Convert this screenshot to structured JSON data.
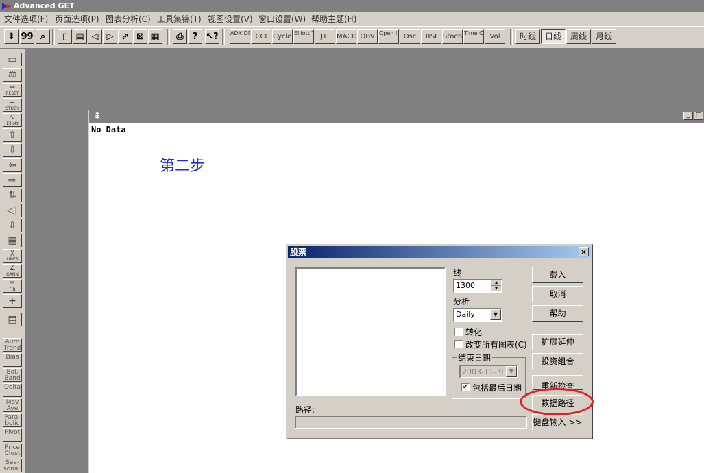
{
  "app": {
    "title": "Advanced GET"
  },
  "menu": [
    "文件选项(F)",
    "页面选项(P)",
    "图表分析(C)",
    "工具集锦(T)",
    "视图设置(V)",
    "窗口设置(W)",
    "帮助主题(H)"
  ],
  "toolbar": {
    "tools_left": [
      {
        "icon": "cursor-icon",
        "glyph": "⇞"
      },
      {
        "icon": "quote-icon",
        "glyph": "99"
      },
      {
        "icon": "magnifier-icon",
        "glyph": "⌕"
      },
      {
        "icon": "page-icon",
        "glyph": "▯"
      },
      {
        "icon": "save-icon",
        "glyph": "▤"
      },
      {
        "icon": "back-icon",
        "glyph": "◁"
      },
      {
        "icon": "forward-icon",
        "glyph": "▷"
      },
      {
        "icon": "export-icon",
        "glyph": "⇗"
      },
      {
        "icon": "delete-page-icon",
        "glyph": "⊠"
      },
      {
        "icon": "chart-page-icon",
        "glyph": "▦"
      },
      {
        "icon": "print-icon",
        "glyph": "⎙"
      },
      {
        "icon": "help-icon",
        "glyph": "?"
      },
      {
        "icon": "context-help-icon",
        "glyph": "↖?"
      }
    ],
    "studies": [
      "ADX DMI",
      "CCI",
      "Cycles",
      "Elliott Trig",
      "JTI",
      "MACD",
      "OBV",
      "Open Int",
      "Osc",
      "RSI",
      "Stoch",
      "Time Clust",
      "Vol"
    ],
    "periods": [
      "时线",
      "日线",
      "周线",
      "月线"
    ],
    "active_period": "日线"
  },
  "left_tools": [
    {
      "icon": "open-folder-icon",
      "glyph": "▭",
      "label": ""
    },
    {
      "icon": "balance-icon",
      "glyph": "⚖",
      "label": ""
    },
    {
      "icon": "reset-icon",
      "glyph": "⇔",
      "label": "RESET"
    },
    {
      "icon": "study-icon",
      "glyph": "═",
      "label": "STUDY"
    },
    {
      "icon": "elliott-icon",
      "glyph": "∿",
      "label": "Elliott"
    },
    {
      "icon": "arrow-up-icon",
      "glyph": "⇧",
      "label": ""
    },
    {
      "icon": "arrow-down-icon",
      "glyph": "⇩",
      "label": ""
    },
    {
      "icon": "arrow-left-icon",
      "glyph": "⇦",
      "label": ""
    },
    {
      "icon": "arrow-right-icon",
      "glyph": "⇨",
      "label": ""
    },
    {
      "icon": "bars-icon",
      "glyph": "⇅",
      "label": ""
    },
    {
      "icon": "expand-h-icon",
      "glyph": "◁|▷",
      "label": ""
    },
    {
      "icon": "expand-v-icon",
      "glyph": "⇳",
      "label": ""
    },
    {
      "icon": "grid-icon",
      "glyph": "▦",
      "label": ""
    },
    {
      "icon": "lines-icon",
      "glyph": "╳",
      "label": "LINES"
    },
    {
      "icon": "gann-icon",
      "glyph": "∠",
      "label": "GANN"
    },
    {
      "icon": "fib-icon",
      "glyph": "≡",
      "label": "FIB"
    },
    {
      "icon": "crosshair-icon",
      "glyph": "+",
      "label": ""
    },
    {
      "icon": "notes-icon",
      "glyph": "▤",
      "label": ""
    }
  ],
  "left_studies": [
    "Auto Trend",
    "Bias",
    "Bol. Band",
    "Delta",
    "Mov Ave",
    "Para- bolic",
    "Pivot",
    "Price Clust",
    "Sea- sonals"
  ],
  "chart": {
    "status": "No Data",
    "annotation": "第二步"
  },
  "dialog": {
    "title": "股票",
    "line_label": "线",
    "line_value": "1300",
    "analysis_label": "分析",
    "analysis_value": "Daily",
    "convert_label": "转化",
    "change_all_label": "改变所有图表(C)",
    "end_date_group": "结束日期",
    "end_date_value": "2003-11- 9",
    "include_latest_label": "包括最后日期",
    "path_label": "路径:",
    "path_value": "",
    "buttons": {
      "load": "载入",
      "cancel": "取消",
      "help": "帮助",
      "extend": "扩展延伸",
      "portfolio": "投资组合",
      "recheck": "重新检查",
      "data_path": "数据路径",
      "keyboard_input": "键盘输入 >>"
    },
    "include_latest_checked": true,
    "convert_checked": false,
    "change_all_checked": false
  },
  "colors": {
    "annotation": "#1a2ecf",
    "highlight_circle": "#e02020",
    "dialog_title": "#0a246a"
  }
}
